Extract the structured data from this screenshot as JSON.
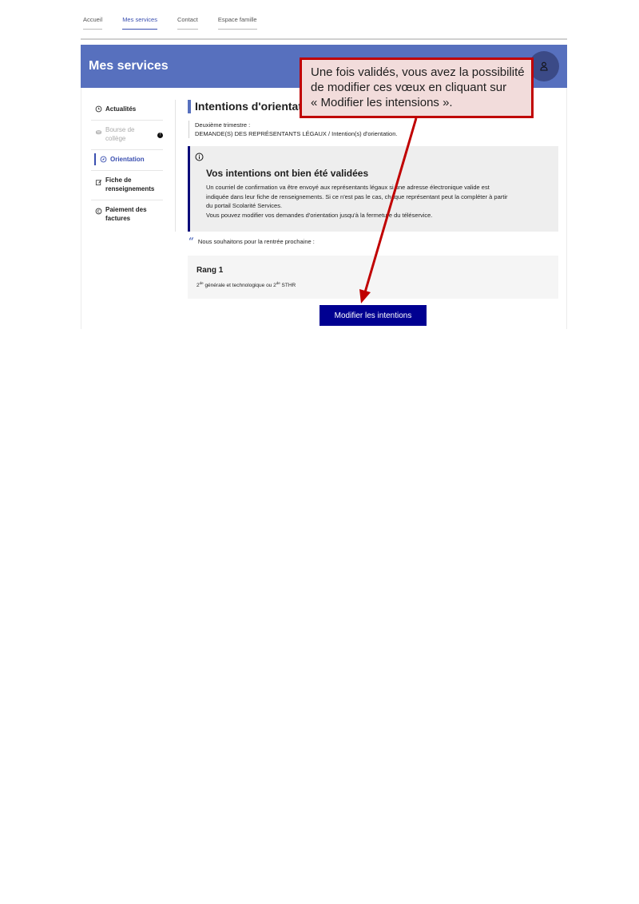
{
  "nav": {
    "items": [
      {
        "label": "Accueil",
        "active": false
      },
      {
        "label": "Mes services",
        "active": true
      },
      {
        "label": "Contact",
        "active": false
      },
      {
        "label": "Espace famille",
        "active": false
      }
    ]
  },
  "banner": {
    "title": "Mes services",
    "color": "#5770be",
    "avatar_icon": "user-icon"
  },
  "sidebar": {
    "items": [
      {
        "label": "Actualités",
        "icon": "clock-icon",
        "state": "normal"
      },
      {
        "label": "Bourse de collège",
        "icon": "coins-icon",
        "state": "disabled",
        "badge": "!"
      },
      {
        "label": "Orientation",
        "icon": "compass-icon",
        "state": "active"
      },
      {
        "label": "Fiche de renseignements",
        "icon": "edit-icon",
        "state": "normal"
      },
      {
        "label": "Paiement des factures",
        "icon": "payment-icon",
        "state": "normal"
      }
    ]
  },
  "main": {
    "title": "Intentions d'orientat",
    "breadcrumb_line1": "Deuxième trimestre :",
    "breadcrumb_line2": "DEMANDE(S) DES REPRÉSENTANTS LÉGAUX / Intention(s) d'orientation.",
    "notice": {
      "title": "Vos intentions ont bien été validées",
      "line1": "Un courriel de confirmation va être envoyé aux représentants légaux si une adresse électronique valide est",
      "line2": "indiquée dans leur fiche de renseignements. Si ce n'est pas le cas, chaque représentant peut la compléter à partir",
      "line3": "du portail Scolarité Services.",
      "line4": "Vous pouvez modifier vos demandes d'orientation jusqu'à la fermeture du téléservice."
    },
    "quote_text": "Nous souhaitons pour la rentrée prochaine :",
    "rank": {
      "title": "Rang 1",
      "desc_a": "2",
      "desc_a_sup": "de",
      "desc_b": " générale et technologique ou 2",
      "desc_b_sup": "de",
      "desc_c": " STHR"
    },
    "modify_button": "Modifier les intentions",
    "button_color": "#000091"
  },
  "callout": {
    "line1": "Une fois validés, vous avez la possibilité",
    "line2": "de modifier ces vœux en cliquant sur",
    "line3": "« Modifier les intensions ».",
    "border_color": "#c00000",
    "fill_color": "#f2dcdb"
  }
}
